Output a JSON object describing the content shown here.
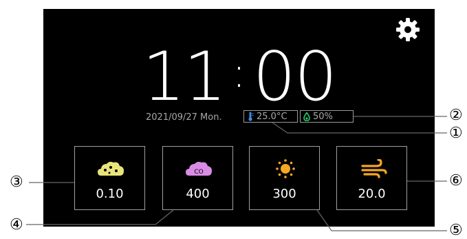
{
  "clock": {
    "hours": "11",
    "separator": ":",
    "minutes": "00"
  },
  "date_line": "2021/09/27 Mon.",
  "temperature": {
    "value": "25.0°C",
    "icon": "thermometer-icon"
  },
  "humidity": {
    "value": "50%",
    "icon": "droplet-icon"
  },
  "settings_icon": "gear-icon",
  "tiles": [
    {
      "id": "pm",
      "icon": "dust-cloud-icon",
      "value": "0.10",
      "color": "#e9e47a"
    },
    {
      "id": "co2",
      "icon": "co2-cloud-icon",
      "icon_text": "CO",
      "value": "400",
      "color": "#d98be6"
    },
    {
      "id": "light",
      "icon": "sun-icon",
      "value": "300",
      "color": "#f5a623"
    },
    {
      "id": "wind",
      "icon": "wind-icon",
      "value": "20.0",
      "color": "#f5a623"
    }
  ],
  "callouts": [
    "①",
    "②",
    "③",
    "④",
    "⑤",
    "⑥"
  ],
  "colors": {
    "screen": "#000000",
    "temp_icon": "#3a8ee6",
    "hum_icon": "#2ecc71",
    "border": "#a0a0a0"
  }
}
